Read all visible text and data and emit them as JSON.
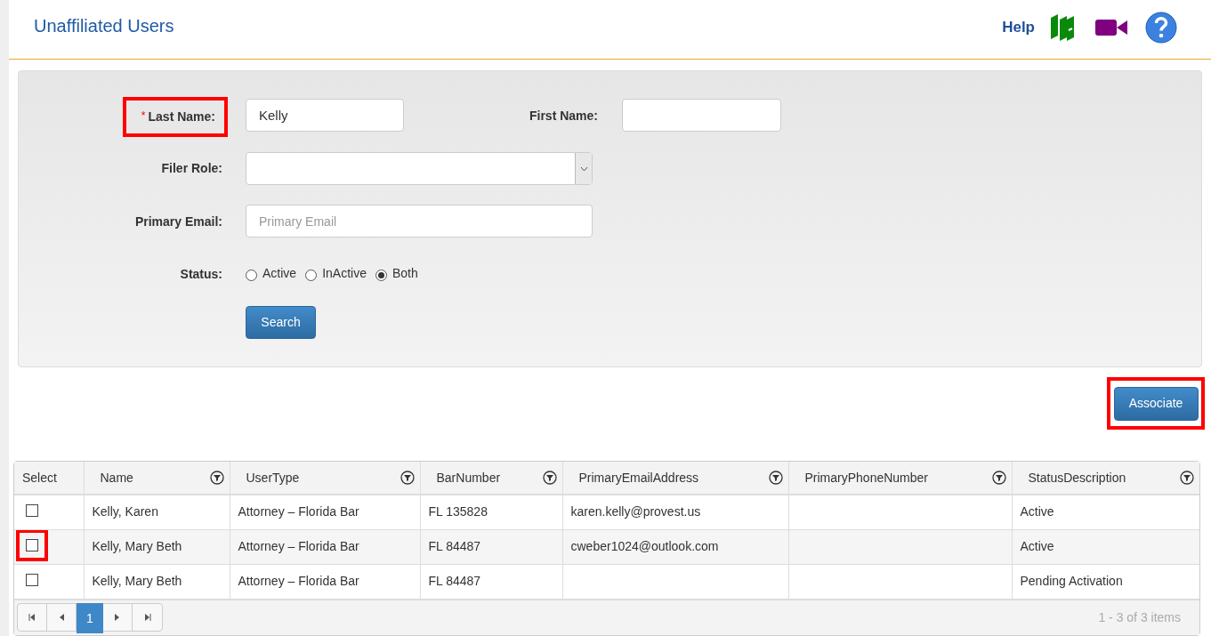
{
  "page": {
    "title": "Unaffiliated Users",
    "help": "Help"
  },
  "form": {
    "last_name": {
      "label": "Last Name:",
      "required_mark": "*",
      "value": "Kelly",
      "highlighted": true
    },
    "first_name": {
      "label": "First Name:"
    },
    "filer_role": {
      "label": "Filer Role:"
    },
    "primary_email": {
      "label": "Primary Email:",
      "placeholder": "Primary Email"
    },
    "status": {
      "label": "Status:",
      "options": [
        {
          "label": "Active",
          "selected": false
        },
        {
          "label": "InActive",
          "selected": false
        },
        {
          "label": "Both",
          "selected": true
        }
      ]
    },
    "search_button": "Search"
  },
  "associate_button": {
    "label": "Associate",
    "highlighted": true
  },
  "table": {
    "columns": [
      "Select",
      "Name",
      "UserType",
      "BarNumber",
      "PrimaryEmailAddress",
      "PrimaryPhoneNumber",
      "StatusDescription"
    ],
    "rows": [
      {
        "checked": false,
        "highlighted": false,
        "cells": [
          "",
          "Kelly, Karen",
          "Attorney – Florida Bar",
          "FL 135828",
          "karen.kelly@provest.us",
          "",
          "Active"
        ]
      },
      {
        "checked": false,
        "highlighted": true,
        "cells": [
          "",
          "Kelly, Mary Beth",
          "Attorney – Florida Bar",
          "FL 84487",
          "cweber1024@outlook.com",
          "",
          "Active"
        ]
      },
      {
        "checked": false,
        "highlighted": false,
        "cells": [
          "",
          "Kelly, Mary Beth",
          "Attorney – Florida Bar",
          "FL 84487",
          "",
          "",
          "Pending Activation"
        ]
      }
    ],
    "pager": {
      "pages": [
        {
          "label": "1",
          "selected": true
        }
      ],
      "summary": "1 - 3 of 3 items"
    }
  }
}
